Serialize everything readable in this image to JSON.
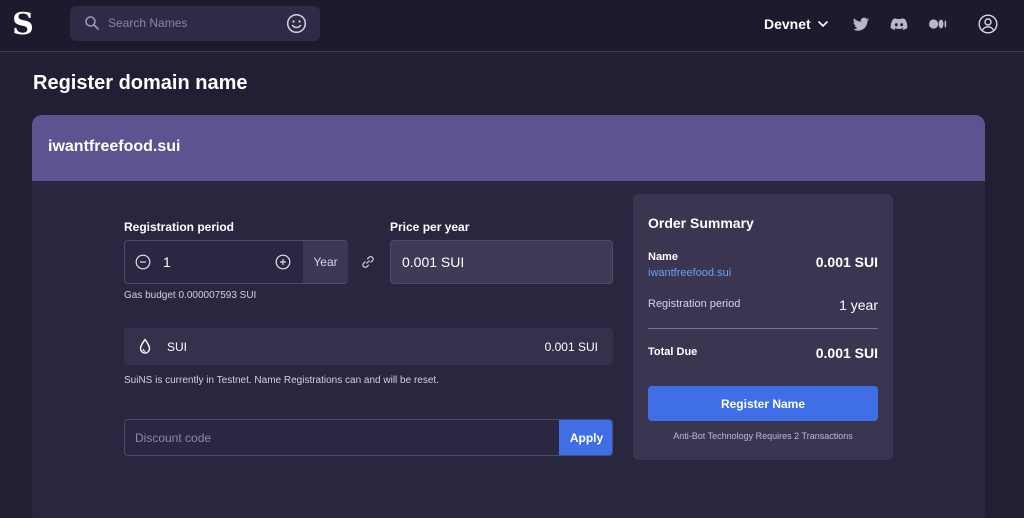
{
  "app": {
    "logo_text": "S"
  },
  "header": {
    "search_placeholder": "Search Names",
    "network_label": "Devnet",
    "icons": [
      "search-icon",
      "emoji-icon",
      "chevron-down-icon",
      "twitter-icon",
      "discord-icon",
      "medium-icon",
      "user-account-icon"
    ]
  },
  "page": {
    "title": "Register domain name",
    "domain": "iwantfreefood.sui"
  },
  "registration": {
    "period_label": "Registration period",
    "period_value": "1",
    "period_unit": "Year",
    "price_label": "Price per year",
    "price_value": "0.001 SUI",
    "gas_budget": "Gas budget 0.000007593 SUI"
  },
  "payment": {
    "token_label": "SUI",
    "token_amount": "0.001 SUI",
    "testnet_note": "SuiNS is currently in Testnet. Name Registrations can and will be reset."
  },
  "discount": {
    "placeholder": "Discount code",
    "apply_label": "Apply"
  },
  "summary": {
    "title": "Order Summary",
    "name_label": "Name",
    "name_value": "iwantfreefood.sui",
    "name_price": "0.001 SUI",
    "period_label": "Registration period",
    "period_value": "1 year",
    "total_label": "Total Due",
    "total_value": "0.001 SUI",
    "register_label": "Register Name",
    "antibot_note": "Anti-Bot Technology Requires 2 Transactions"
  },
  "colors": {
    "background": "#221f35",
    "header_band": "#5c5390",
    "card": "#292640",
    "summary_panel": "#3a3652",
    "accent_button": "#3f6ee6",
    "link": "#6f9ff2"
  }
}
